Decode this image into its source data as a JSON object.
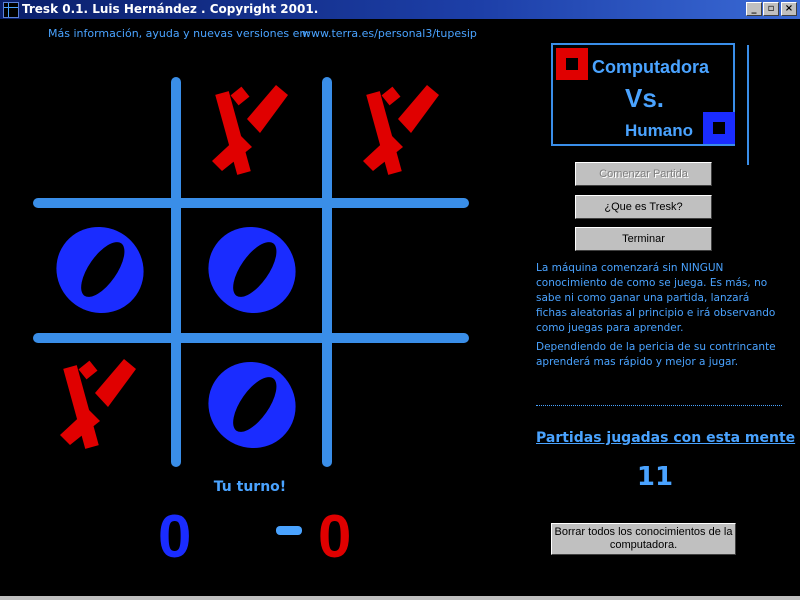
{
  "window": {
    "title": "Tresk 0.1. Luis Hernández . Copyright 2001.",
    "controls": [
      "minimize-icon",
      "maximize-icon",
      "close-icon"
    ]
  },
  "info": {
    "label": "Más información, ayuda y nuevas versiones en:",
    "url": "www.terra.es/personal3/tupesip"
  },
  "board": {
    "cells": [
      "",
      "X",
      "X",
      "O",
      "O",
      "",
      "X",
      "O",
      ""
    ],
    "colors": {
      "grid": "#3a8ee8",
      "X": "#e00000",
      "O": "#1a2cff"
    }
  },
  "panel": {
    "computer_label": "Computadora",
    "vs_label": "Vs.",
    "human_label": "Humano",
    "start_button": "Comenzar Partida",
    "what_button": "¿Que es Tresk?",
    "end_button": "Terminar",
    "description_1": "La máquina comenzará sin NINGUN conocimiento de como se juega. Es más, no sabe ni como ganar una partida, lanzará fichas aleatorias al principio e irá observando como juegas para aprender.",
    "description_2": "Dependiendo de la pericia de su contrincante aprenderá mas rápido y mejor a jugar.",
    "games_label": "Partidas jugadas con esta mente",
    "games_count": "11",
    "erase_button": "Borrar todos los conocimientos de la computadora."
  },
  "status": {
    "turn": "Tu turno!",
    "human_score": "0",
    "computer_score": "0"
  }
}
